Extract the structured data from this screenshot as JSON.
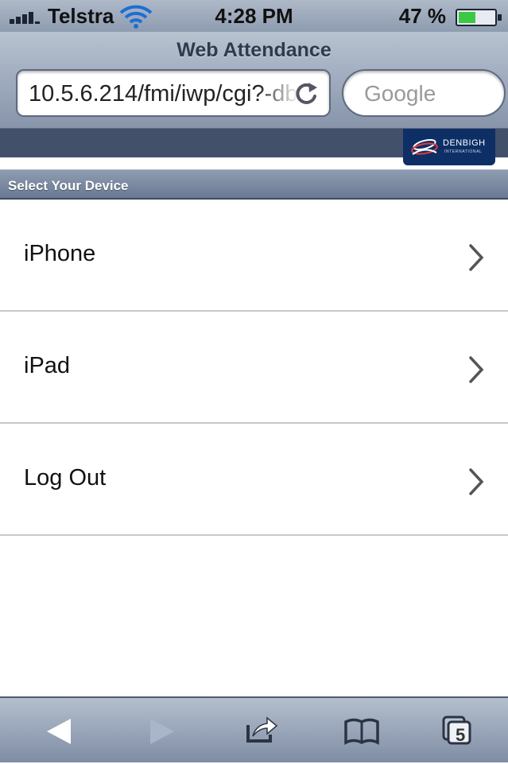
{
  "status_bar": {
    "carrier": "Telstra",
    "time": "4:28 PM",
    "battery_percent": "47 %",
    "battery_level": 0.47
  },
  "browser": {
    "page_title": "Web Attendance",
    "url": "10.5.6.214/fmi/iwp/cgi?-db=",
    "search_placeholder": "Google"
  },
  "site": {
    "logo_name": "DENBIGH",
    "logo_subtitle": "INTERNATIONAL"
  },
  "section": {
    "title": "Select Your Device"
  },
  "items": [
    {
      "label": "iPhone"
    },
    {
      "label": "iPad"
    },
    {
      "label": "Log Out"
    }
  ],
  "toolbar": {
    "tab_count": "5"
  },
  "colors": {
    "chrome": "#8e9cb0",
    "banner": "#42506a",
    "logo_bg": "#0d2f66",
    "battery": "#3cc845",
    "wifi": "#1a6fd6"
  }
}
